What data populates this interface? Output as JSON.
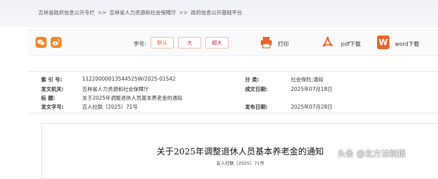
{
  "breadcrumb": {
    "items": [
      "吉林省政府信息公开专栏",
      ">>",
      "吉林省人力资源和社会保障厅",
      ">>",
      "政府信息公开基础平台"
    ]
  },
  "toolbar": {
    "share_icons": [
      "wechat-icon",
      "weibo-icon"
    ],
    "font_size_label": "字号:",
    "font_sizes": [
      "默认",
      "大",
      "超大"
    ],
    "print_label": "打印",
    "pdf_label": "pdf下载",
    "word_label": "word下载",
    "word_icon_letter": "W",
    "accent": "#e8632b"
  },
  "meta": {
    "index_key": "索 引 号:",
    "index_val": "11220000013544525W/2025-01542",
    "category_key": "分      类:",
    "category_val": "社会保险;通知",
    "issuer_key": "发文机关:",
    "issuer_val": "吉林省人力资源和社会保障厅",
    "created_key": "成文日期:",
    "created_val": "2025年07月18日",
    "title_key": "标      题:",
    "title_val": "关于2025年调整退休人员基本养老金的通知",
    "docno_key": "发文字号:",
    "docno_val": "吉人社联〔2025〕71号",
    "published_key": "发布日期:",
    "published_val": "2025年07月28日"
  },
  "document": {
    "title": "关于2025年调整退休人员基本养老金的通知",
    "number": "吉人社联〔2025〕71号"
  },
  "watermark": "头条 @北方法制报"
}
